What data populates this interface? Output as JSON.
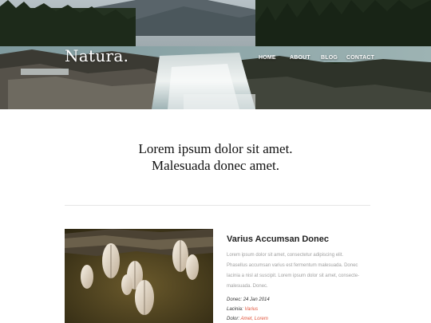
{
  "header": {
    "brand": "Natura.",
    "nav": [
      {
        "label": "HOME"
      },
      {
        "label": "ABOUT"
      },
      {
        "label": "BLOG"
      },
      {
        "label": "CONTACT"
      }
    ]
  },
  "intro": {
    "line1": "Lorem ipsum dolor sit amet.",
    "line2": "Malesuada donec amet."
  },
  "article": {
    "title": "Varius Accumsan Donec",
    "body_lines": [
      "Lorem ipsum dolor sit amet, consectetur adipiscing elit.",
      "Phasellus accumsan varius est fermentum malesuada. Donec",
      "lacinia a nisl at suscipit. Lorem ipsum dolor sit amet, consecte-",
      "malesuada. Donec."
    ],
    "meta": {
      "donec_label": "Donec:",
      "donec_value": "24 Jan 2014",
      "lacinia_label": "Lacinia:",
      "lacinia_value": "Varius",
      "dolor_label": "Dolor:",
      "dolor_value": "Amet, Lorem"
    }
  },
  "colors": {
    "link_accent": "#e0533a",
    "body_text": "#a0a0a0",
    "heading": "#222222"
  },
  "icons": [
    "waterfall-hero-image",
    "snail-shells-thumbnail"
  ]
}
